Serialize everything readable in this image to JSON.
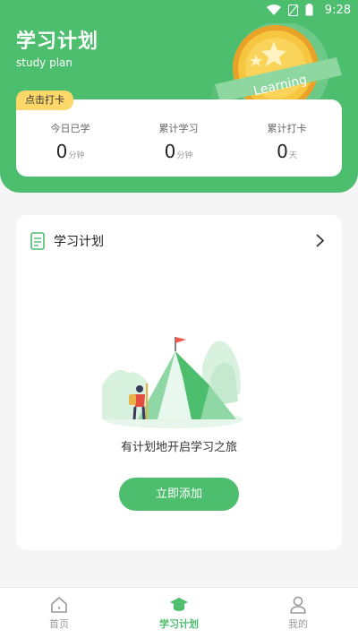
{
  "status_bar": {
    "time": "9:28"
  },
  "header": {
    "title": "学习计划",
    "subtitle": "study plan",
    "badge_text": "Learning"
  },
  "stats": {
    "badge": "点击打卡",
    "items": [
      {
        "label": "今日已学",
        "value": "0",
        "unit": "分钟"
      },
      {
        "label": "累计学习",
        "value": "0",
        "unit": "分钟"
      },
      {
        "label": "累计打卡",
        "value": "0",
        "unit": "天"
      }
    ]
  },
  "plan": {
    "title": "学习计划",
    "empty_text": "有计划地开启学习之旅",
    "add_button": "立即添加"
  },
  "tabs": [
    {
      "label": "首页",
      "icon": "home-icon",
      "active": false
    },
    {
      "label": "学习计划",
      "icon": "graduation-cap-icon",
      "active": true
    },
    {
      "label": "我的",
      "icon": "user-icon",
      "active": false
    }
  ],
  "colors": {
    "accent": "#4dbd6e",
    "badge": "#fcd86b",
    "background": "#f5f5f5"
  }
}
